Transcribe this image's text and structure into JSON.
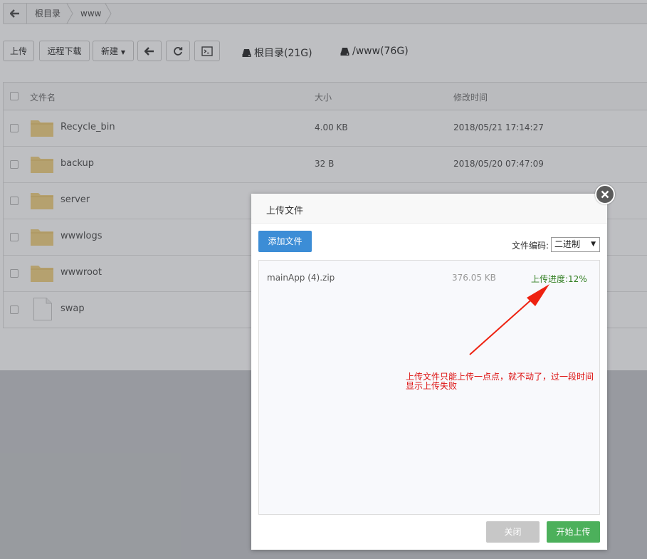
{
  "breadcrumb": {
    "items": [
      "根目录",
      "www"
    ]
  },
  "toolbar": {
    "upload": "上传",
    "remote_download": "远程下载",
    "new": "新建",
    "disks": [
      "根目录(21G)",
      "/www(76G)"
    ]
  },
  "table": {
    "headers": [
      "文件名",
      "大小",
      "修改时间"
    ],
    "rows": [
      {
        "name": "Recycle_bin",
        "type": "folder",
        "size": "4.00 KB",
        "date": "2018/05/21 17:14:27"
      },
      {
        "name": "backup",
        "type": "folder",
        "size": "32 B",
        "date": "2018/05/20 07:47:09"
      },
      {
        "name": "server",
        "type": "folder",
        "size": "",
        "date": ""
      },
      {
        "name": "wwwlogs",
        "type": "folder",
        "size": "",
        "date": ""
      },
      {
        "name": "wwwroot",
        "type": "folder",
        "size": "",
        "date": ""
      },
      {
        "name": "swap",
        "type": "file",
        "size": "",
        "date": ""
      }
    ]
  },
  "dialog": {
    "title": "上传文件",
    "add_file": "添加文件",
    "encoding_label": "文件编码:",
    "encoding_value": "二进制",
    "file": {
      "name": "mainApp (4).zip",
      "size": "376.05 KB",
      "progress": "上传进度:12%"
    },
    "close": "关闭",
    "start": "开始上传"
  },
  "annotation": {
    "text_line1": "上传文件只能上传一点点，就不动了，过一段时间",
    "text_line2": "显示上传失败"
  },
  "colors": {
    "primary": "#3c8dd6",
    "success": "#4cb05b",
    "progress_text": "#2f7d1f",
    "annotation": "#dd1111",
    "folder": "#f3d589"
  }
}
